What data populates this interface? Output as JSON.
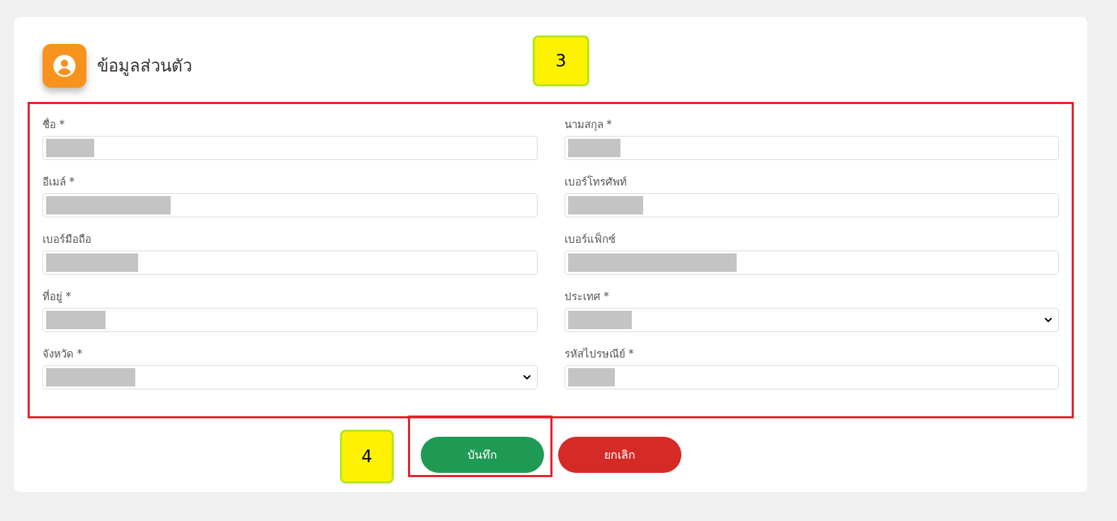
{
  "section": {
    "title": "ข้อมูลส่วนตัว"
  },
  "fields": [
    {
      "label": "ชื่อ *",
      "kind": "text",
      "redacted": true
    },
    {
      "label": "นามสกุล *",
      "kind": "text",
      "redacted": true
    },
    {
      "label": "อีเมล์ *",
      "kind": "text",
      "redacted": true
    },
    {
      "label": "เบอร์โทรศัพท์",
      "kind": "text",
      "redacted": true
    },
    {
      "label": "เบอร์มือถือ",
      "kind": "text",
      "redacted": true
    },
    {
      "label": "เบอร์แฟ็กซ์",
      "kind": "text",
      "redacted": true
    },
    {
      "label": "ที่อยู่ *",
      "kind": "text",
      "redacted": true
    },
    {
      "label": "ประเทศ *",
      "kind": "select",
      "redacted": true
    },
    {
      "label": "จังหวัด *",
      "kind": "select",
      "redacted": true
    },
    {
      "label": "รหัสไปรษณีย์ *",
      "kind": "text",
      "redacted": true
    }
  ],
  "buttons": [
    {
      "label": "บันทึก",
      "kind": "save"
    },
    {
      "label": "ยกเลิก",
      "kind": "cancel"
    }
  ],
  "callouts": [
    {
      "label": "3"
    },
    {
      "label": "4"
    }
  ]
}
